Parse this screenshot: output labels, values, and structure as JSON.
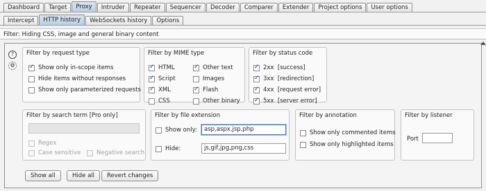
{
  "top_tabs": [
    "Dashboard",
    "Target",
    "Proxy",
    "Intruder",
    "Repeater",
    "Sequencer",
    "Decoder",
    "Comparer",
    "Extender",
    "Project options",
    "User options"
  ],
  "sub_tabs": [
    "Intercept",
    "HTTP history",
    "WebSockets history",
    "Options"
  ],
  "filter_bar": "Filter: Hiding CSS, image and general binary content",
  "icons": {
    "help": "?",
    "settings": "⚙"
  },
  "request_type": {
    "title": "Filter by request type",
    "options": [
      "Show only in-scope items",
      "Hide items without responses",
      "Show only parameterized requests"
    ]
  },
  "mime": {
    "title": "Filter by MIME type",
    "col1": [
      "HTML",
      "Script",
      "XML",
      "CSS"
    ],
    "col2": [
      "Other text",
      "Images",
      "Flash",
      "Other binary"
    ]
  },
  "status": {
    "title": "Filter by status code",
    "options": [
      "2xx  [success]",
      "3xx  [redirection]",
      "4xx  [request error]",
      "5xx  [server error]"
    ]
  },
  "search": {
    "title": "Filter by search term [Pro only]",
    "regex": "Regex",
    "case": "Case sensitive",
    "negative": "Negative search"
  },
  "extension": {
    "title": "Filter by file extension",
    "show_label": "Show only:",
    "show_value": "asp,aspx,jsp,php",
    "hide_label": "Hide:",
    "hide_value": "js,gif,jpg,png,css"
  },
  "annotation": {
    "title": "Filter by annotation",
    "commented": "Show only commented items",
    "highlighted": "Show only highlighted items"
  },
  "listener": {
    "title": "Filter by listener",
    "port_label": "Port"
  },
  "buttons": {
    "show_all": "Show all",
    "hide_all": "Hide all",
    "revert": "Revert changes"
  }
}
